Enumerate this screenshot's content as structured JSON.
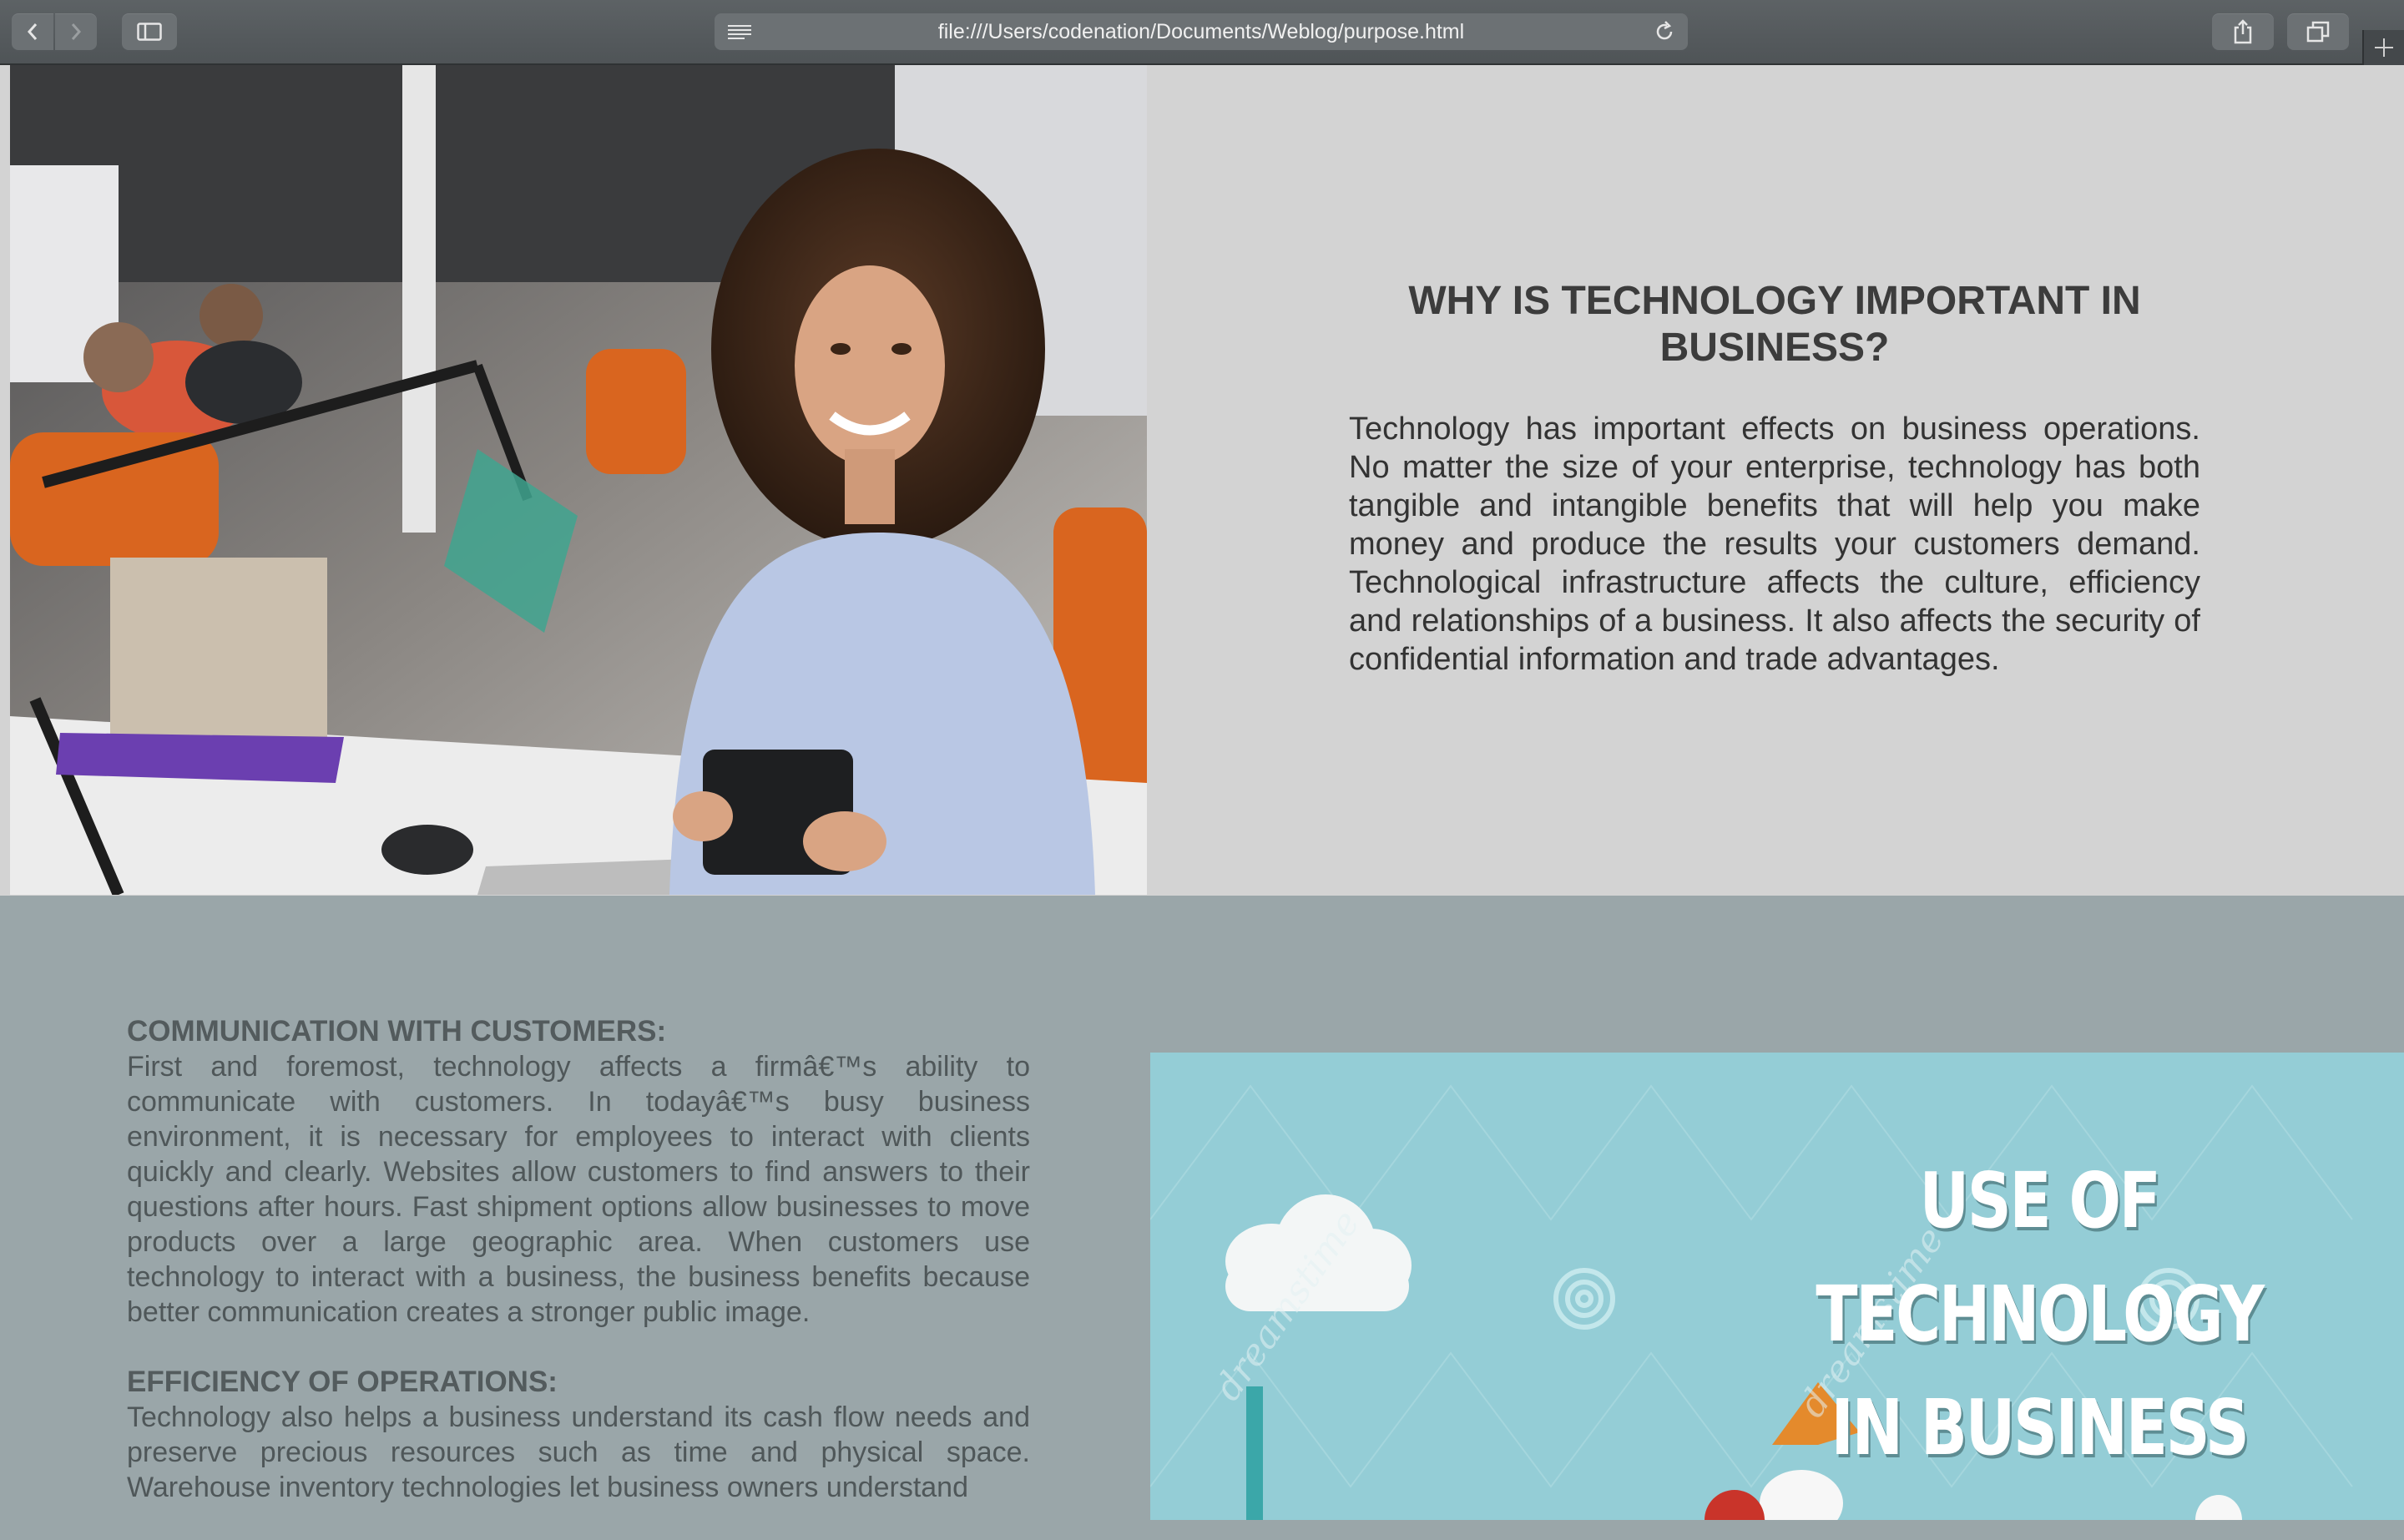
{
  "browser": {
    "url": "file:///Users/codenation/Documents/Weblog/purpose.html",
    "icons": [
      "back-icon",
      "forward-icon",
      "sidebar-icon",
      "reader-icon",
      "reload-icon",
      "share-icon",
      "tabs-icon",
      "new-tab-icon"
    ]
  },
  "intro": {
    "heading": "WHY IS TECHNOLOGY IMPORTANT IN BUSINESS?",
    "body": "Technology has important effects on business operations. No matter the size of your enterprise, technology has both tangible and intangible benefits that will help you make money and produce the results your customers demand. Technological infrastructure affects the culture, efficiency and relationships of a business. It also affects the security of confidential information and trade advantages."
  },
  "sections": [
    {
      "heading": "COMMUNICATION WITH CUSTOMERS:",
      "body": "First and foremost, technology affects a firmâ€™s ability to communicate with customers. In todayâ€™s busy business environment, it is necessary for employees to interact with clients quickly and clearly. Websites allow customers to find answers to their questions after hours. Fast shipment options allow businesses to move products over a large geographic area. When customers use technology to interact with a business, the business benefits because better communication creates a stronger public image."
    },
    {
      "heading": "EFFICIENCY OF OPERATIONS:",
      "body": "Technology also helps a business understand its cash flow needs and preserve precious resources such as time and physical space. Warehouse inventory technologies let business owners understand"
    }
  ],
  "poster": {
    "line1": "USE OF TECHNOLOGY",
    "line2": "IN BUSINESS",
    "watermark": "dreamstime"
  }
}
